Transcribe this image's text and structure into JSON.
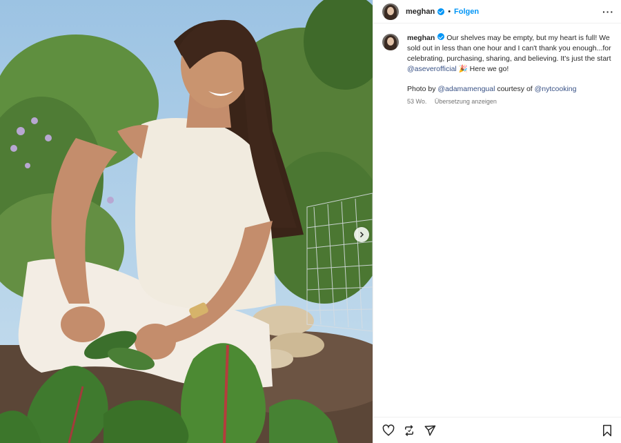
{
  "post": {
    "username": "meghan",
    "follow_label": "Folgen",
    "separator": "•",
    "more_label": "···"
  },
  "caption": {
    "username": "meghan",
    "text_part1": "Our shelves may be empty, but my heart is full! We sold out in less than one hour and I can't thank you enough...for celebrating, purchasing, sharing, and believing. It's just the start ",
    "mention_brand": "@aseverofficial",
    "emoji": "🎉",
    "text_part2": " Here we go!",
    "credit_prefix": "Photo by ",
    "credit_photographer": "@adamamengual",
    "credit_middle": " courtesy of ",
    "credit_outlet": "@nytcooking",
    "age": "53 Wo.",
    "translate_label": "Übersetzung anzeigen"
  },
  "colors": {
    "accent": "#0095f6",
    "link": "#385185",
    "muted": "#737373"
  },
  "icons": {
    "like": "heart-icon",
    "repost": "repost-icon",
    "share": "send-icon",
    "save": "bookmark-icon",
    "next": "chevron-right-icon"
  }
}
